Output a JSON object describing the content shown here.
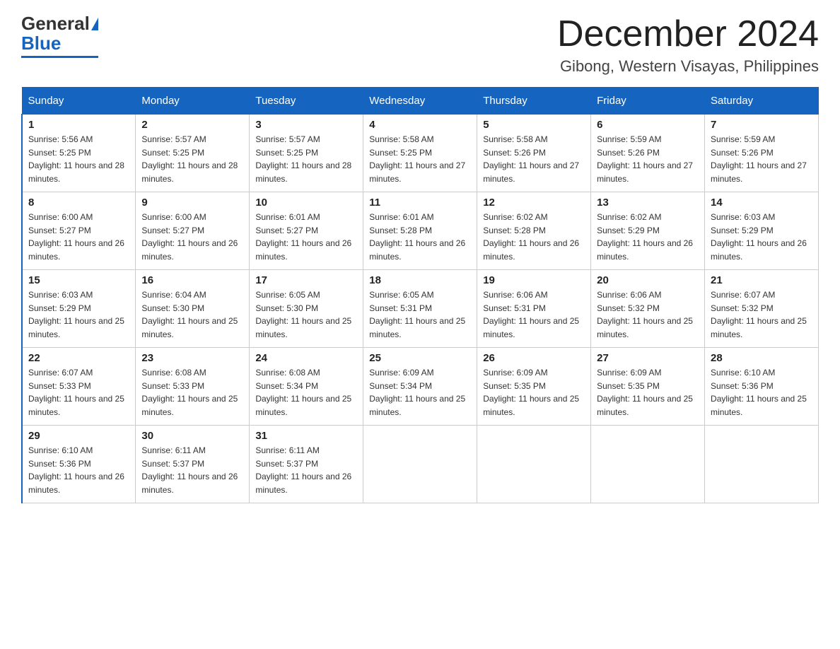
{
  "logo": {
    "general": "General",
    "blue": "Blue"
  },
  "header": {
    "month_year": "December 2024",
    "location": "Gibong, Western Visayas, Philippines"
  },
  "days_of_week": [
    "Sunday",
    "Monday",
    "Tuesday",
    "Wednesday",
    "Thursday",
    "Friday",
    "Saturday"
  ],
  "weeks": [
    [
      {
        "day": "1",
        "sunrise": "Sunrise: 5:56 AM",
        "sunset": "Sunset: 5:25 PM",
        "daylight": "Daylight: 11 hours and 28 minutes."
      },
      {
        "day": "2",
        "sunrise": "Sunrise: 5:57 AM",
        "sunset": "Sunset: 5:25 PM",
        "daylight": "Daylight: 11 hours and 28 minutes."
      },
      {
        "day": "3",
        "sunrise": "Sunrise: 5:57 AM",
        "sunset": "Sunset: 5:25 PM",
        "daylight": "Daylight: 11 hours and 28 minutes."
      },
      {
        "day": "4",
        "sunrise": "Sunrise: 5:58 AM",
        "sunset": "Sunset: 5:25 PM",
        "daylight": "Daylight: 11 hours and 27 minutes."
      },
      {
        "day": "5",
        "sunrise": "Sunrise: 5:58 AM",
        "sunset": "Sunset: 5:26 PM",
        "daylight": "Daylight: 11 hours and 27 minutes."
      },
      {
        "day": "6",
        "sunrise": "Sunrise: 5:59 AM",
        "sunset": "Sunset: 5:26 PM",
        "daylight": "Daylight: 11 hours and 27 minutes."
      },
      {
        "day": "7",
        "sunrise": "Sunrise: 5:59 AM",
        "sunset": "Sunset: 5:26 PM",
        "daylight": "Daylight: 11 hours and 27 minutes."
      }
    ],
    [
      {
        "day": "8",
        "sunrise": "Sunrise: 6:00 AM",
        "sunset": "Sunset: 5:27 PM",
        "daylight": "Daylight: 11 hours and 26 minutes."
      },
      {
        "day": "9",
        "sunrise": "Sunrise: 6:00 AM",
        "sunset": "Sunset: 5:27 PM",
        "daylight": "Daylight: 11 hours and 26 minutes."
      },
      {
        "day": "10",
        "sunrise": "Sunrise: 6:01 AM",
        "sunset": "Sunset: 5:27 PM",
        "daylight": "Daylight: 11 hours and 26 minutes."
      },
      {
        "day": "11",
        "sunrise": "Sunrise: 6:01 AM",
        "sunset": "Sunset: 5:28 PM",
        "daylight": "Daylight: 11 hours and 26 minutes."
      },
      {
        "day": "12",
        "sunrise": "Sunrise: 6:02 AM",
        "sunset": "Sunset: 5:28 PM",
        "daylight": "Daylight: 11 hours and 26 minutes."
      },
      {
        "day": "13",
        "sunrise": "Sunrise: 6:02 AM",
        "sunset": "Sunset: 5:29 PM",
        "daylight": "Daylight: 11 hours and 26 minutes."
      },
      {
        "day": "14",
        "sunrise": "Sunrise: 6:03 AM",
        "sunset": "Sunset: 5:29 PM",
        "daylight": "Daylight: 11 hours and 26 minutes."
      }
    ],
    [
      {
        "day": "15",
        "sunrise": "Sunrise: 6:03 AM",
        "sunset": "Sunset: 5:29 PM",
        "daylight": "Daylight: 11 hours and 25 minutes."
      },
      {
        "day": "16",
        "sunrise": "Sunrise: 6:04 AM",
        "sunset": "Sunset: 5:30 PM",
        "daylight": "Daylight: 11 hours and 25 minutes."
      },
      {
        "day": "17",
        "sunrise": "Sunrise: 6:05 AM",
        "sunset": "Sunset: 5:30 PM",
        "daylight": "Daylight: 11 hours and 25 minutes."
      },
      {
        "day": "18",
        "sunrise": "Sunrise: 6:05 AM",
        "sunset": "Sunset: 5:31 PM",
        "daylight": "Daylight: 11 hours and 25 minutes."
      },
      {
        "day": "19",
        "sunrise": "Sunrise: 6:06 AM",
        "sunset": "Sunset: 5:31 PM",
        "daylight": "Daylight: 11 hours and 25 minutes."
      },
      {
        "day": "20",
        "sunrise": "Sunrise: 6:06 AM",
        "sunset": "Sunset: 5:32 PM",
        "daylight": "Daylight: 11 hours and 25 minutes."
      },
      {
        "day": "21",
        "sunrise": "Sunrise: 6:07 AM",
        "sunset": "Sunset: 5:32 PM",
        "daylight": "Daylight: 11 hours and 25 minutes."
      }
    ],
    [
      {
        "day": "22",
        "sunrise": "Sunrise: 6:07 AM",
        "sunset": "Sunset: 5:33 PM",
        "daylight": "Daylight: 11 hours and 25 minutes."
      },
      {
        "day": "23",
        "sunrise": "Sunrise: 6:08 AM",
        "sunset": "Sunset: 5:33 PM",
        "daylight": "Daylight: 11 hours and 25 minutes."
      },
      {
        "day": "24",
        "sunrise": "Sunrise: 6:08 AM",
        "sunset": "Sunset: 5:34 PM",
        "daylight": "Daylight: 11 hours and 25 minutes."
      },
      {
        "day": "25",
        "sunrise": "Sunrise: 6:09 AM",
        "sunset": "Sunset: 5:34 PM",
        "daylight": "Daylight: 11 hours and 25 minutes."
      },
      {
        "day": "26",
        "sunrise": "Sunrise: 6:09 AM",
        "sunset": "Sunset: 5:35 PM",
        "daylight": "Daylight: 11 hours and 25 minutes."
      },
      {
        "day": "27",
        "sunrise": "Sunrise: 6:09 AM",
        "sunset": "Sunset: 5:35 PM",
        "daylight": "Daylight: 11 hours and 25 minutes."
      },
      {
        "day": "28",
        "sunrise": "Sunrise: 6:10 AM",
        "sunset": "Sunset: 5:36 PM",
        "daylight": "Daylight: 11 hours and 25 minutes."
      }
    ],
    [
      {
        "day": "29",
        "sunrise": "Sunrise: 6:10 AM",
        "sunset": "Sunset: 5:36 PM",
        "daylight": "Daylight: 11 hours and 26 minutes."
      },
      {
        "day": "30",
        "sunrise": "Sunrise: 6:11 AM",
        "sunset": "Sunset: 5:37 PM",
        "daylight": "Daylight: 11 hours and 26 minutes."
      },
      {
        "day": "31",
        "sunrise": "Sunrise: 6:11 AM",
        "sunset": "Sunset: 5:37 PM",
        "daylight": "Daylight: 11 hours and 26 minutes."
      },
      null,
      null,
      null,
      null
    ]
  ]
}
